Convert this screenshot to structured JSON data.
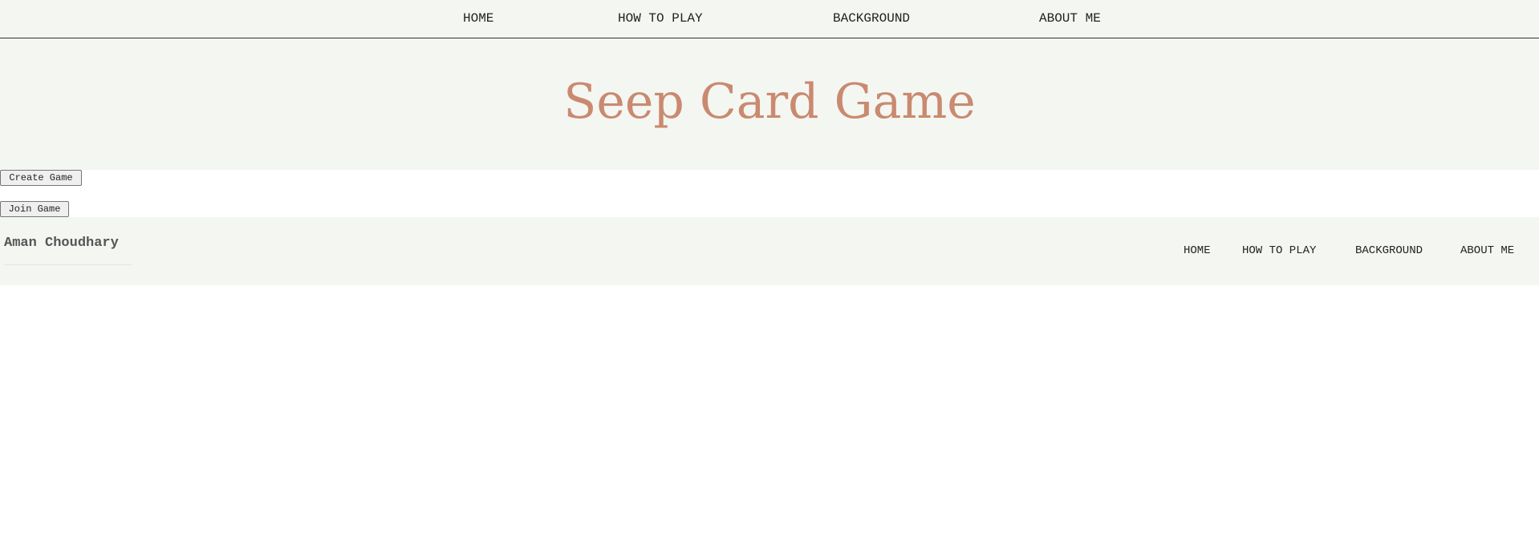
{
  "header": {
    "nav": [
      "HOME",
      "HOW TO PLAY",
      "BACKGROUND",
      "ABOUT ME"
    ]
  },
  "hero": {
    "title": "Seep Card Game"
  },
  "actions": {
    "create_label": "Create Game",
    "join_label": "Join Game"
  },
  "footer": {
    "author": "Aman Choudhary",
    "nav": [
      "HOME",
      "HOW TO PLAY",
      "BACKGROUND",
      "ABOUT ME"
    ]
  },
  "colors": {
    "title": "#c98a70",
    "band_background": "#f4f6f2",
    "text": "#222222"
  }
}
